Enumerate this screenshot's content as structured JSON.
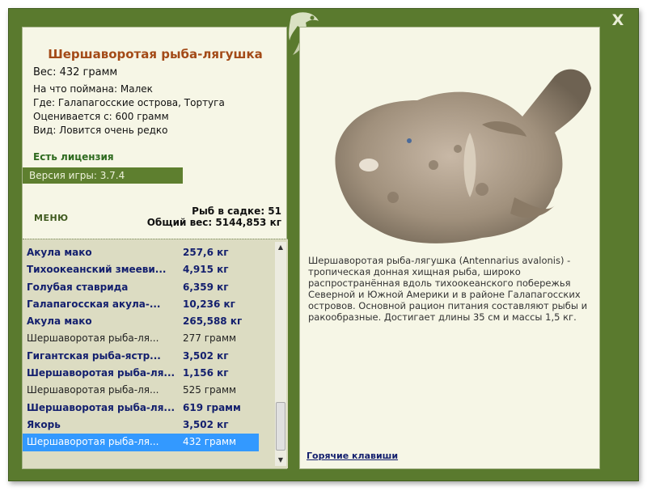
{
  "window": {
    "close_label": "X"
  },
  "fish": {
    "title": "Шершаворотая рыба-лягушка",
    "weight": "Вес: 432 грамм",
    "info": [
      "На что поймана: Малек",
      "Где: Галапагосские острова, Тортуга",
      "Оценивается с: 600 грамм",
      "Вид: Ловится очень редко"
    ],
    "license": "Есть лицензия",
    "version": "Версия игры: 3.7.4",
    "description": "Шершаворотая рыба-лягушка (Antennarius avalonis) - тропическая донная хищная рыба, широко распространённая вдоль тихоокеанского побережья Северной и Южной Америки и в районе Галапагосских островов. Основной рацион питания составляют рыбы и ракообразные. Достигает длины 35 см и массы 1,5 кг."
  },
  "menu": {
    "label": "МЕНЮ"
  },
  "stats": {
    "count": "Рыб в садке: 51",
    "total": "Общий вес: 5144,853 кг"
  },
  "catch_list": [
    {
      "name": "Акула мако",
      "value": "257,6 кг",
      "style": "bold"
    },
    {
      "name": "Тихоокеанский змееви...",
      "value": "4,915 кг",
      "style": "bold"
    },
    {
      "name": "Голубая ставрида",
      "value": "6,359 кг",
      "style": "bold"
    },
    {
      "name": "Галапагосская акула-...",
      "value": "10,236 кг",
      "style": "bold"
    },
    {
      "name": "Акула мако",
      "value": "265,588 кг",
      "style": "bold"
    },
    {
      "name": "Шершаворотая рыба-ля...",
      "value": "277 грамм",
      "style": "plain"
    },
    {
      "name": "Гигантская рыба-ястр...",
      "value": "3,502 кг",
      "style": "bold"
    },
    {
      "name": "Шершаворотая рыба-ля...",
      "value": "1,156 кг",
      "style": "bold"
    },
    {
      "name": "Шершаворотая рыба-ля...",
      "value": "525 грамм",
      "style": "plain"
    },
    {
      "name": "Шершаворотая рыба-ля...",
      "value": "619 грамм",
      "style": "bold"
    },
    {
      "name": "Якорь",
      "value": "3,502 кг",
      "style": "bold"
    },
    {
      "name": "Шершаворотая рыба-ля...",
      "value": "432 грамм",
      "style": "sel"
    }
  ],
  "hotkeys": {
    "label": "Горячие клавиши"
  },
  "colors": {
    "frame": "#5a7a2e",
    "panel": "#f6f6e6",
    "title": "#a34a17",
    "list_bg": "#dcdcc2",
    "selection": "#3399ff",
    "link": "#14206e"
  },
  "icons": [
    "close-icon",
    "fish-logo-icon",
    "scroll-up-icon",
    "scroll-down-icon"
  ]
}
